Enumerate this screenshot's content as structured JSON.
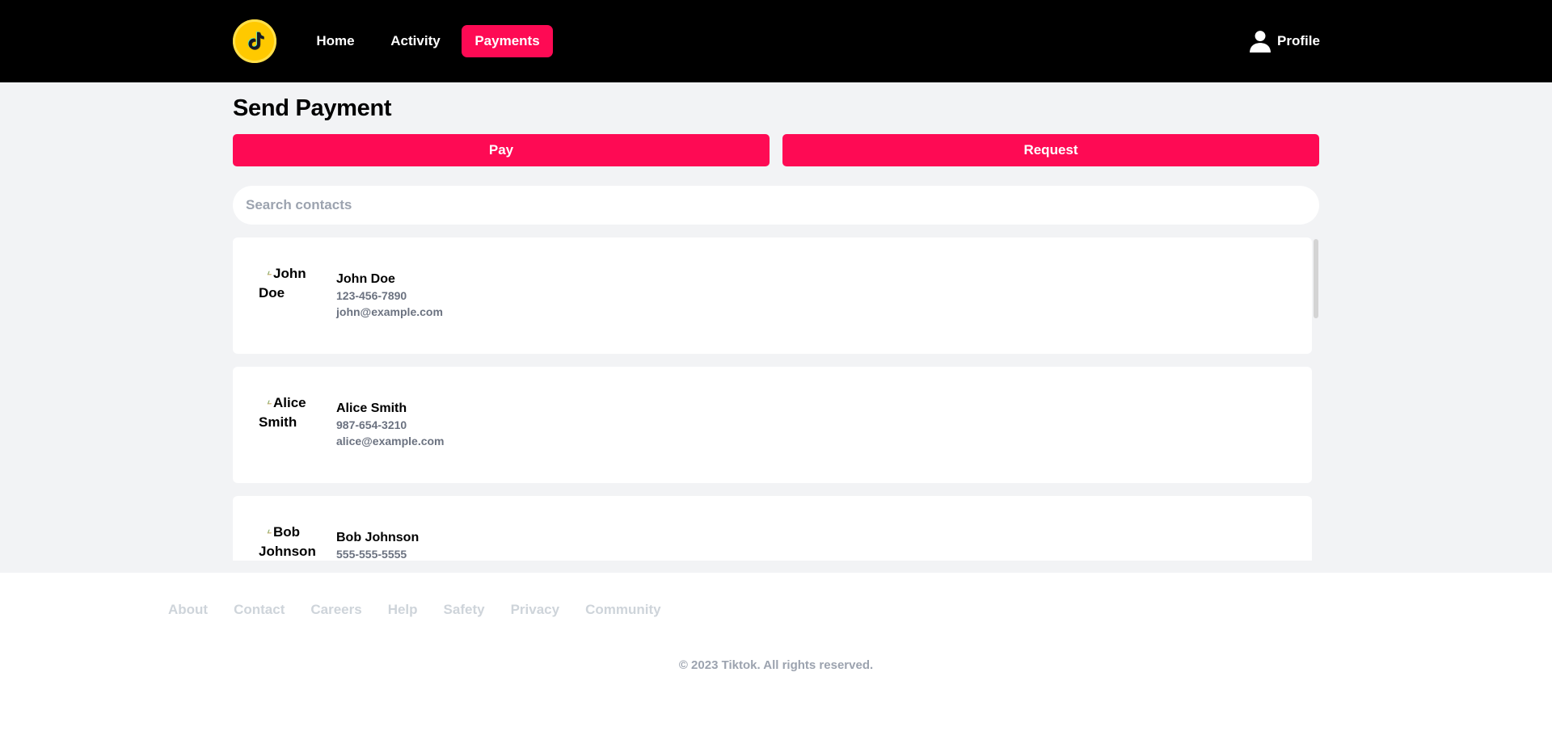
{
  "header": {
    "logo_icon": "tiktok-logo-icon",
    "nav": [
      {
        "label": "Home"
      },
      {
        "label": "Activity"
      },
      {
        "label": "Payments",
        "active": true
      }
    ],
    "profile_label": "Profile",
    "profile_icon": "user-icon",
    "accent": "#fe0a54"
  },
  "main": {
    "title": "Send Payment",
    "pay_label": "Pay",
    "request_label": "Request",
    "search_placeholder": "Search contacts",
    "contacts": [
      {
        "avatar_alt_line1": "John",
        "avatar_alt_line2": "Doe",
        "name": "John Doe",
        "phone": "123-456-7890",
        "email": "john@example.com"
      },
      {
        "avatar_alt_line1": "Alice",
        "avatar_alt_line2": "Smith",
        "name": "Alice Smith",
        "phone": "987-654-3210",
        "email": "alice@example.com"
      },
      {
        "avatar_alt_line1": "Bob",
        "avatar_alt_line2": "Johnson",
        "name": "Bob Johnson",
        "phone": "555-555-5555",
        "email": ""
      }
    ]
  },
  "footer": {
    "links": [
      "About",
      "Contact",
      "Careers",
      "Help",
      "Safety",
      "Privacy",
      "Community"
    ],
    "copyright": "© 2023 Tiktok. All rights reserved."
  }
}
